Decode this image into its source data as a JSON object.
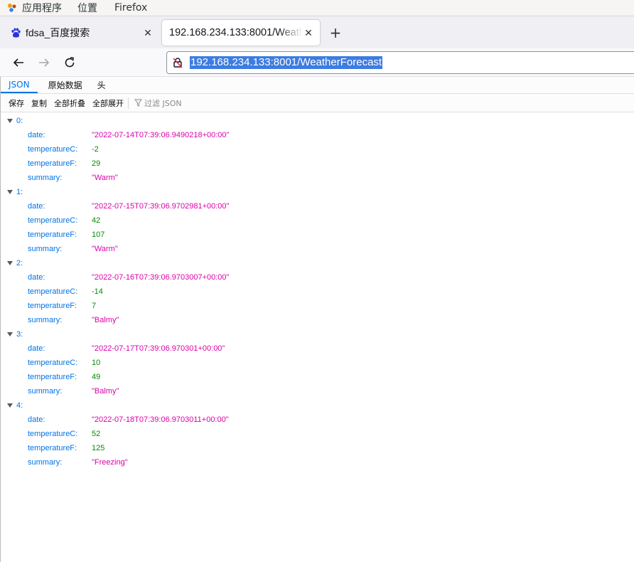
{
  "topbar": {
    "apps": "应用程序",
    "places": "位置",
    "firefox": "Firefox"
  },
  "tabs": [
    {
      "title": "fdsa_百度搜索",
      "close": "✕"
    },
    {
      "title": "192.168.234.133:8001/WeatherForecast",
      "close": "✕"
    }
  ],
  "newtab": "+",
  "urlbar": {
    "url": "192.168.234.133:8001/WeatherForecast"
  },
  "viewer": {
    "tabs": [
      "JSON",
      "原始数据",
      "头"
    ],
    "toolbar": {
      "save": "保存",
      "copy": "复制",
      "collapse_all": "全部折叠",
      "expand_all": "全部展开",
      "filter": "过滤 JSON"
    }
  },
  "items": [
    {
      "index": "0:",
      "date": "\"2022-07-14T07:39:06.9490218+00:00\"",
      "temperatureC": "-2",
      "temperatureF": "29",
      "summary": "\"Warm\""
    },
    {
      "index": "1:",
      "date": "\"2022-07-15T07:39:06.9702981+00:00\"",
      "temperatureC": "42",
      "temperatureF": "107",
      "summary": "\"Warm\""
    },
    {
      "index": "2:",
      "date": "\"2022-07-16T07:39:06.9703007+00:00\"",
      "temperatureC": "-14",
      "temperatureF": "7",
      "summary": "\"Balmy\""
    },
    {
      "index": "3:",
      "date": "\"2022-07-17T07:39:06.970301+00:00\"",
      "temperatureC": "10",
      "temperatureF": "49",
      "summary": "\"Balmy\""
    },
    {
      "index": "4:",
      "date": "\"2022-07-18T07:39:06.9703011+00:00\"",
      "temperatureC": "52",
      "temperatureF": "125",
      "summary": "\"Freezing\""
    }
  ],
  "keys": {
    "date": "date:",
    "temperatureC": "temperatureC:",
    "temperatureF": "temperatureF:",
    "summary": "summary:"
  }
}
